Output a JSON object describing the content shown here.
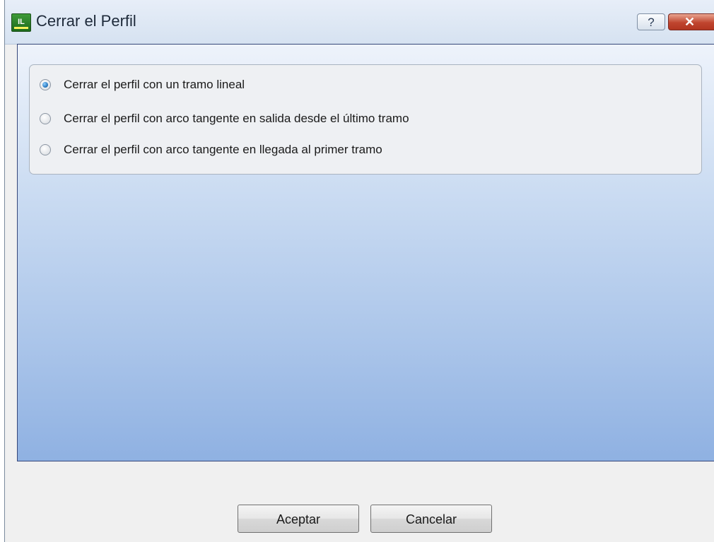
{
  "window": {
    "title": "Cerrar el Perfil",
    "help_label": "?",
    "close_label": "✕"
  },
  "options": [
    {
      "label": "Cerrar el perfil con un tramo lineal",
      "selected": true
    },
    {
      "label": "Cerrar el perfil con arco tangente en salida desde el último tramo",
      "selected": false
    },
    {
      "label": "Cerrar el perfil con arco tangente en llegada al primer tramo",
      "selected": false
    }
  ],
  "buttons": {
    "ok_label": "Aceptar",
    "cancel_label": "Cancelar"
  },
  "colors": {
    "panel_top": "#eef3fb",
    "panel_bottom": "#8fb1e2",
    "close_button": "#c0452f"
  }
}
